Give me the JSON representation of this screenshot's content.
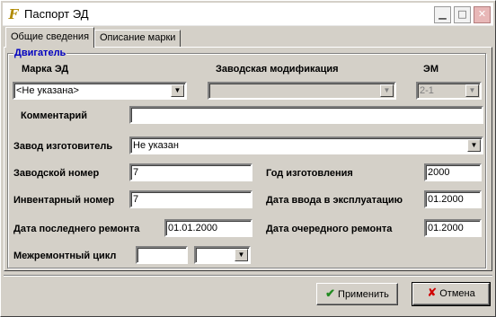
{
  "window": {
    "title": "Паспорт ЭД",
    "icon": "app-icon"
  },
  "title_buttons": {
    "minimize": "minimize-icon",
    "maximize": "maximize-icon",
    "close": "close-icon"
  },
  "tabs": [
    {
      "label": "Общие сведения",
      "active": true
    },
    {
      "label": "Описание марки",
      "active": false
    }
  ],
  "group": {
    "title": "Двигатель"
  },
  "labels": {
    "brand": "Марка ЭД",
    "factory_mod": "Заводская модификация",
    "em": "ЭМ",
    "comment": "Комментарий",
    "manufacturer": "Завод изготовитель",
    "serial": "Заводской номер",
    "year": "Год изготовления",
    "inventory": "Инвентарный номер",
    "commission_date": "Дата ввода в эксплуатацию",
    "last_repair": "Дата последнего ремонта",
    "next_repair": "Дата очередного ремонта",
    "repair_cycle": "Межремонтный цикл"
  },
  "fields": {
    "brand": "<Не указана>",
    "factory_mod": "",
    "em": "2-1",
    "comment": "",
    "manufacturer": "Не указан",
    "serial": "7",
    "year": "2000",
    "inventory": "7",
    "commission_date": "01.2000",
    "last_repair": "01.01.2000",
    "next_repair": "01.2000",
    "repair_cycle_value": "",
    "repair_cycle_unit": ""
  },
  "buttons": {
    "apply": "Применить",
    "cancel": "Отмена"
  },
  "colors": {
    "group_title": "#0000c0",
    "face": "#d4d0c8",
    "apply_icon": "#228b22",
    "cancel_icon": "#d00000"
  }
}
